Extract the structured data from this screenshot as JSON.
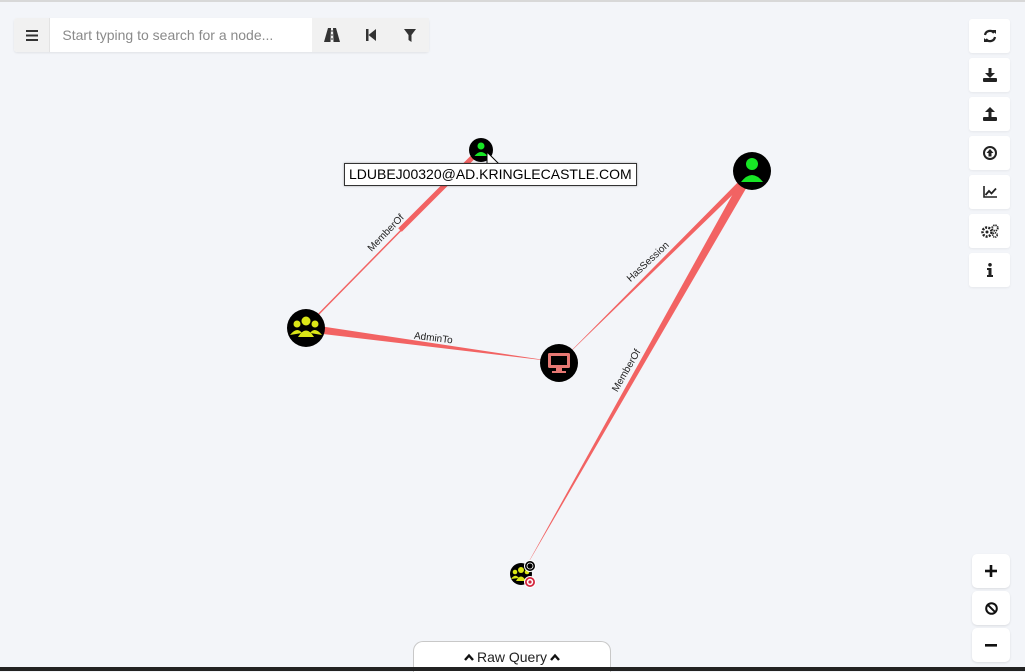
{
  "search": {
    "placeholder": "Start typing to search for a node..."
  },
  "toolbar": {
    "menu_icon": "hamburger-icon",
    "tools": [
      "pathfinding-icon",
      "back-icon",
      "filter-icon"
    ]
  },
  "right_panel": {
    "buttons": [
      "refresh-icon",
      "export-icon",
      "import-icon",
      "upload-icon",
      "chart-icon",
      "settings-icon",
      "info-icon"
    ]
  },
  "zoom": {
    "buttons": [
      "zoom-in-icon",
      "reset-icon",
      "zoom-out-icon"
    ]
  },
  "graph": {
    "tooltip": "LDUBEJ00320@AD.KRINGLECASTLE.COM",
    "edges": [
      {
        "label": "MemberOf"
      },
      {
        "label": "AdminTo"
      },
      {
        "label": "HasSession"
      },
      {
        "label": "MemberOf"
      }
    ],
    "colors": {
      "edge": "#f26363",
      "user_node": "#17e625",
      "group_node": "#dbe617",
      "computer_node": "#e67873"
    }
  },
  "raw_query": {
    "label": "Raw Query"
  }
}
